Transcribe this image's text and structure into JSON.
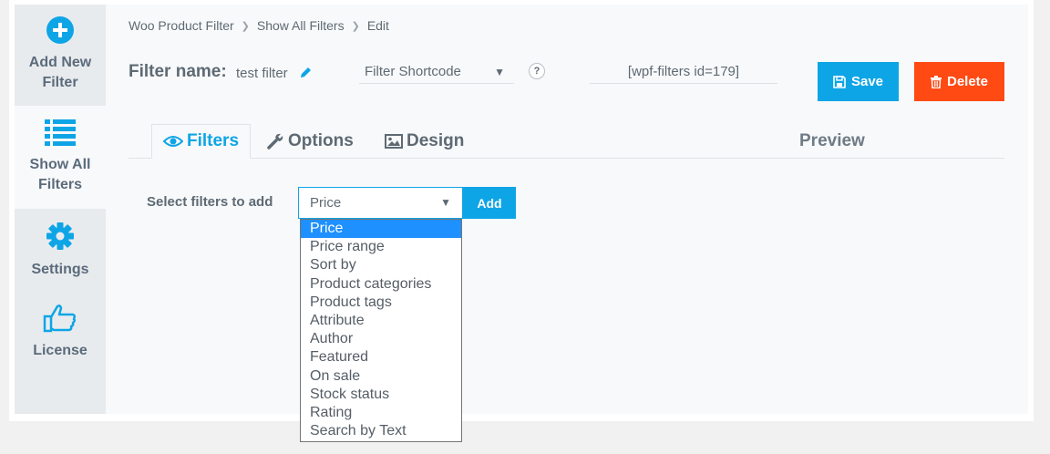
{
  "sidebar": {
    "items": [
      {
        "label": "Add New Filter",
        "icon": "plus-circle-icon"
      },
      {
        "label": "Show All Filters",
        "icon": "list-icon"
      },
      {
        "label": "Settings",
        "icon": "gear-icon"
      },
      {
        "label": "License",
        "icon": "thumbs-up-icon"
      }
    ],
    "accent_color": "#0ea5e6"
  },
  "breadcrumb": {
    "items": [
      "Woo Product Filter",
      "Show All Filters",
      "Edit"
    ]
  },
  "header": {
    "filter_name_label": "Filter name:",
    "filter_name_value": "test filter",
    "shortcode_select": "Filter Shortcode",
    "help": "?",
    "shortcode_value": "[wpf-filters id=179]",
    "save_label": "Save",
    "delete_label": "Delete",
    "save_color": "#0ea5e6",
    "delete_color": "#ff4a14"
  },
  "tabs": [
    {
      "label": "Filters",
      "icon": "eye-icon",
      "active": true
    },
    {
      "label": "Options",
      "icon": "wrench-icon",
      "active": false
    },
    {
      "label": "Design",
      "icon": "image-icon",
      "active": false
    }
  ],
  "preview_label": "Preview",
  "filter_add": {
    "label": "Select filters to add",
    "selected": "Price",
    "add_label": "Add",
    "options": [
      "Price",
      "Price range",
      "Sort by",
      "Product categories",
      "Product tags",
      "Attribute",
      "Author",
      "Featured",
      "On sale",
      "Stock status",
      "Rating",
      "Search by Text"
    ]
  }
}
